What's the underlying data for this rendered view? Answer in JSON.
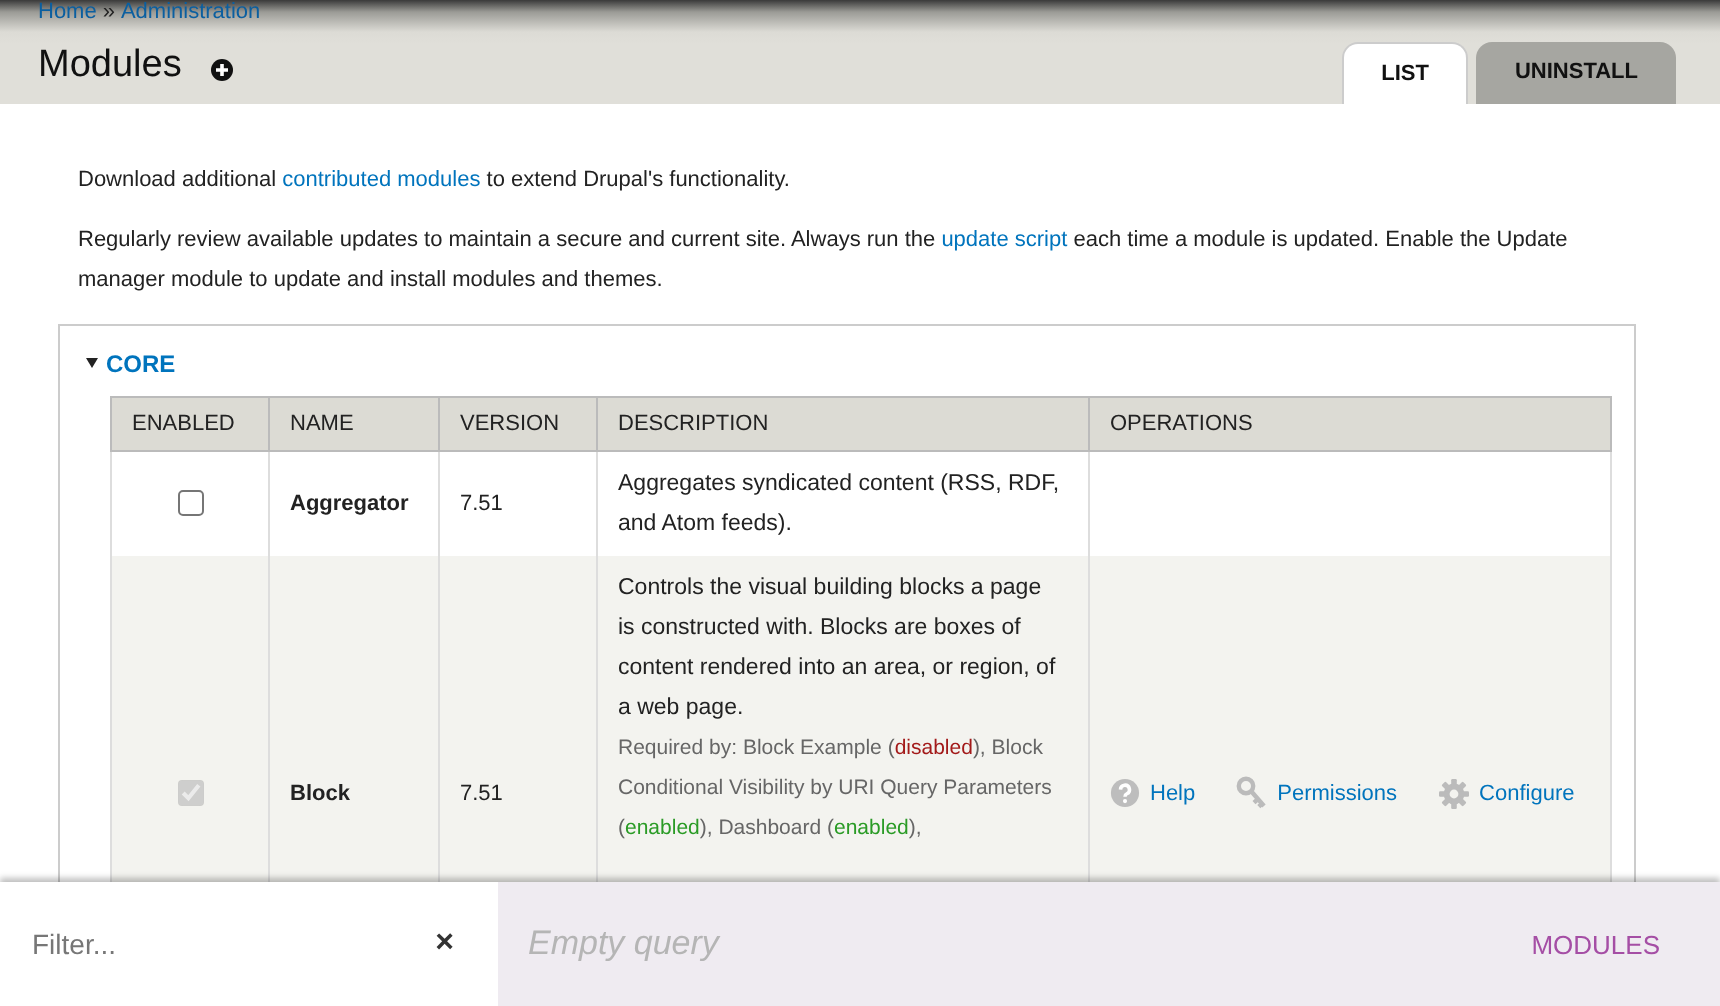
{
  "breadcrumb": [
    {
      "label": "Home"
    },
    {
      "label": "Administration"
    }
  ],
  "breadcrumb_separator": "»",
  "page_title": "Modules",
  "tabs": [
    {
      "label": "LIST",
      "selected": true
    },
    {
      "label": "UNINSTALL",
      "selected": false
    }
  ],
  "intro": [
    {
      "before": "Download additional ",
      "link": "contributed modules",
      "after": " to extend Drupal's functionality."
    },
    {
      "before": "Regularly review available updates to maintain a secure and current site. Always run the ",
      "link": "update script",
      "after": " each time a module is updated. Enable the Update manager module to update and install modules and themes."
    }
  ],
  "fieldset": {
    "legend": "CORE",
    "expanded": true
  },
  "table": {
    "columns": [
      "ENABLED",
      "NAME",
      "VERSION",
      "DESCRIPTION",
      "OPERATIONS"
    ],
    "rows": [
      {
        "enabled": false,
        "disabled": false,
        "name": "Aggregator",
        "version": "7.51",
        "description": "Aggregates syndicated content (RSS, RDF, and Atom feeds).",
        "required_by": [],
        "operations": []
      },
      {
        "enabled": true,
        "disabled": true,
        "name": "Block",
        "version": "7.51",
        "description": "Controls the visual building blocks a page is constructed with. Blocks are boxes of content rendered into an area, or region, of a web page.",
        "required_by": [
          {
            "text": "Required by: Block Example ("
          },
          {
            "text": "disabled",
            "kind": "disabled"
          },
          {
            "text": "), Block Conditional Visibility by URI Query Parameters ("
          },
          {
            "text": "enabled",
            "kind": "enabled"
          },
          {
            "text": "), Dashboard ("
          },
          {
            "text": "enabled",
            "kind": "enabled"
          },
          {
            "text": "),"
          }
        ],
        "operations": [
          {
            "label": "Help",
            "kind": "help"
          },
          {
            "label": "Permissions",
            "kind": "permissions"
          },
          {
            "label": "Configure",
            "kind": "configure"
          }
        ]
      }
    ]
  },
  "filter_bar": {
    "placeholder": "Filter...",
    "clear": "×",
    "query_placeholder": "Empty query",
    "scope": "MODULES"
  }
}
